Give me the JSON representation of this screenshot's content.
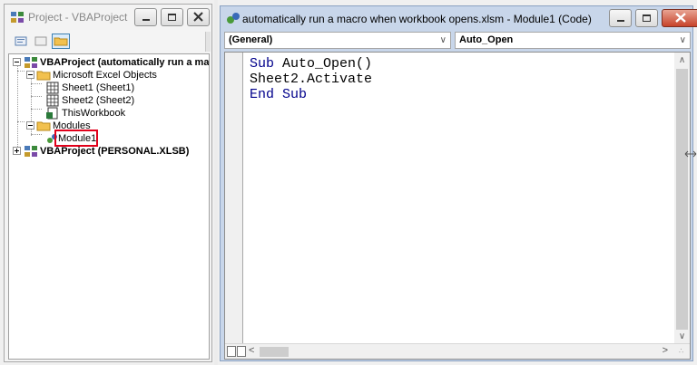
{
  "project_window": {
    "title": "Project - VBAProject",
    "tree": {
      "vbaproject_1": "VBAProject (automatically run a macro wl",
      "excel_objects": "Microsoft Excel Objects",
      "sheet1": "Sheet1 (Sheet1)",
      "sheet2": "Sheet2 (Sheet2)",
      "thisworkbook": "ThisWorkbook",
      "modules": "Modules",
      "module1": "Module1",
      "vbaproject_2": "VBAProject (PERSONAL.XLSB)"
    },
    "selected_item": "Module1",
    "highlight_color": "#e1001a"
  },
  "code_window": {
    "title": "automatically run a macro when workbook opens.xlsm - Module1 (Code)",
    "object_combo": "(General)",
    "procedure_combo": "Auto_Open",
    "code": {
      "line1_kw": "Sub",
      "line1_rest": " Auto_Open()",
      "line2": "Sheet2.Activate",
      "line3_kw": "End Sub"
    },
    "keyword_color": "#00008b"
  }
}
